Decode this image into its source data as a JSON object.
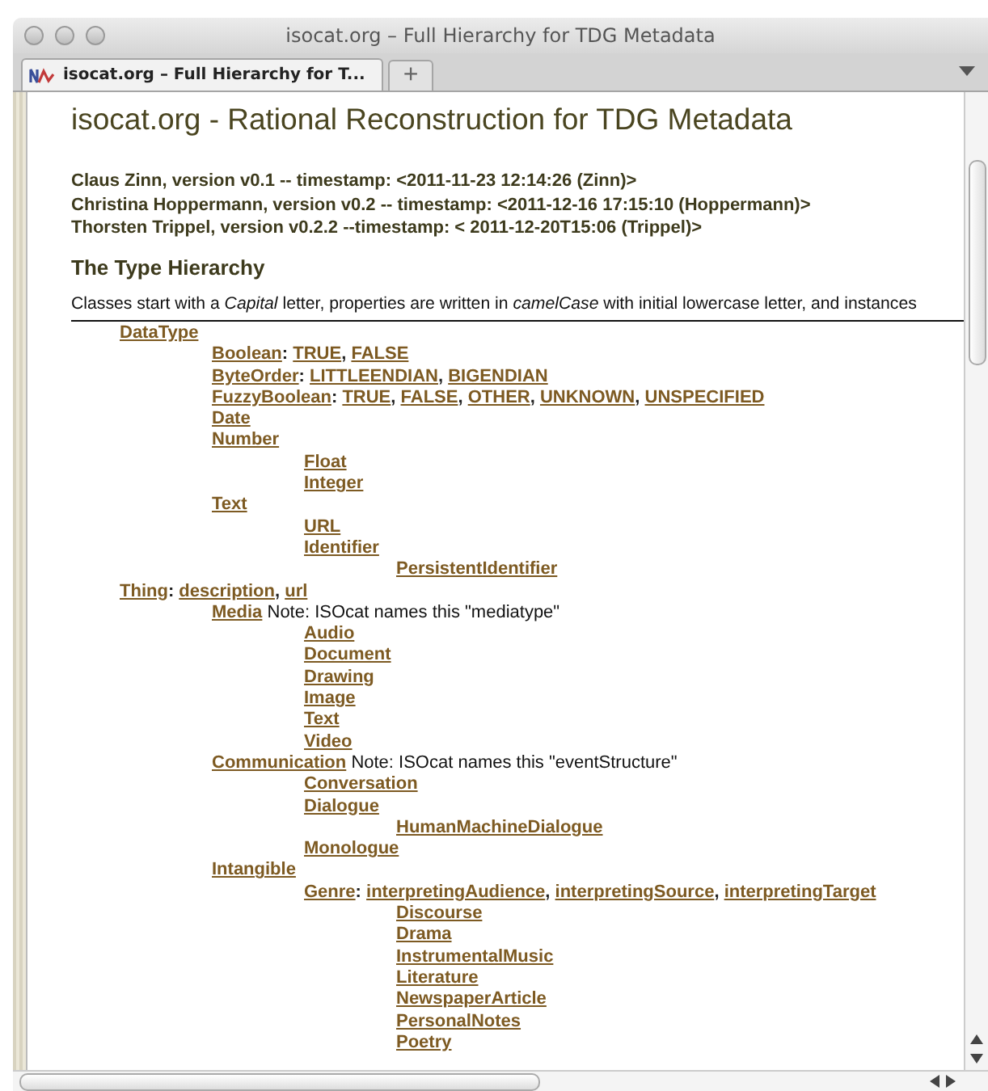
{
  "window": {
    "title": "isocat.org – Full Hierarchy for TDG Metadata"
  },
  "tabs": [
    {
      "label": "isocat.org – Full Hierarchy for T...",
      "selected": true
    }
  ],
  "new_tab": "+",
  "page": {
    "heading": "isocat.org - Rational Reconstruction for TDG Metadata",
    "versions": [
      "Claus Zinn, version v0.1 -- timestamp: <2011-11-23 12:14:26 (Zinn)>",
      "Christina Hoppermann, version v0.2 -- timestamp: <2011-12-16 17:15:10 (Hoppermann)>",
      "Thorsten Trippel, version v0.2.2 --timestamp: < 2011-12-20T15:06 (Trippel)>"
    ],
    "section_title": "The Type Hierarchy",
    "intro": "Classes start with a *Capital* letter, properties are written in *camelCase* with initial lowercase letter, and instances"
  },
  "hierarchy": {
    "lead": ":",
    "separator": ",",
    "nodes": [
      {
        "name": "DataType",
        "children": [
          {
            "name": "Boolean",
            "props": [
              "TRUE",
              "FALSE"
            ]
          },
          {
            "name": "ByteOrder",
            "props": [
              "LITTLEENDIAN",
              "BIGENDIAN"
            ]
          },
          {
            "name": "FuzzyBoolean",
            "props": [
              "TRUE",
              "FALSE",
              "OTHER",
              "UNKNOWN",
              "UNSPECIFIED"
            ]
          },
          {
            "name": "Date"
          },
          {
            "name": "Number",
            "children": [
              {
                "name": "Float"
              },
              {
                "name": "Integer"
              }
            ]
          },
          {
            "name": "Text",
            "children": [
              {
                "name": "URL"
              },
              {
                "name": "Identifier",
                "children": [
                  {
                    "name": "PersistentIdentifier"
                  }
                ]
              }
            ]
          }
        ]
      },
      {
        "name": "Thing",
        "props": [
          "description",
          "url"
        ],
        "children": [
          {
            "name": "Media",
            "note": "Note: ISOcat names this \"mediatype\"",
            "children": [
              {
                "name": "Audio"
              },
              {
                "name": "Document"
              },
              {
                "name": "Drawing"
              },
              {
                "name": "Image"
              },
              {
                "name": "Text"
              },
              {
                "name": "Video"
              }
            ]
          },
          {
            "name": "Communication",
            "note": "Note: ISOcat names this \"eventStructure\"",
            "children": [
              {
                "name": "Conversation"
              },
              {
                "name": "Dialogue",
                "children": [
                  {
                    "name": "HumanMachineDialogue"
                  }
                ]
              },
              {
                "name": "Monologue"
              }
            ]
          },
          {
            "name": "Intangible",
            "children": [
              {
                "name": "Genre",
                "props": [
                  "interpretingAudience",
                  "interpretingSource",
                  "interpretingTarget"
                ],
                "children": [
                  {
                    "name": "Discourse"
                  },
                  {
                    "name": "Drama"
                  },
                  {
                    "name": "InstrumentalMusic"
                  },
                  {
                    "name": "Literature"
                  },
                  {
                    "name": "NewspaperArticle"
                  },
                  {
                    "name": "PersonalNotes"
                  },
                  {
                    "name": "Poetry"
                  }
                ]
              }
            ]
          }
        ]
      }
    ]
  }
}
